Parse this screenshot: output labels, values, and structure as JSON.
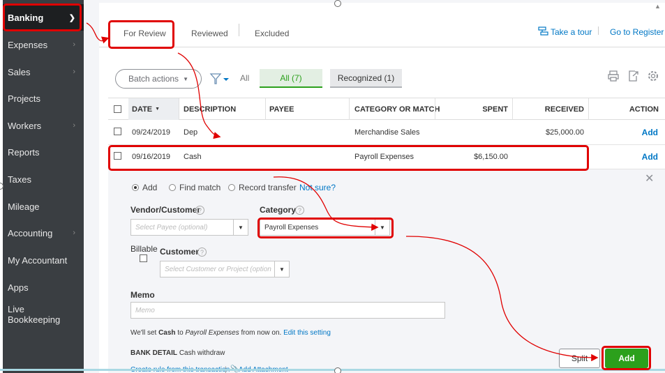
{
  "sidebar": {
    "items": [
      {
        "label": "Banking",
        "chevron": true,
        "active": true
      },
      {
        "label": "Expenses",
        "chevron": true
      },
      {
        "label": "Sales",
        "chevron": true
      },
      {
        "label": "Projects",
        "chevron": false
      },
      {
        "label": "Workers",
        "chevron": true
      },
      {
        "label": "Reports",
        "chevron": false
      },
      {
        "label": "Taxes",
        "chevron": false
      },
      {
        "label": "Mileage",
        "chevron": false
      },
      {
        "label": "Accounting",
        "chevron": true
      },
      {
        "label": "My Accountant",
        "chevron": false
      },
      {
        "label": "Apps",
        "chevron": false
      },
      {
        "label": "Live Bookkeeping",
        "chevron": false
      }
    ]
  },
  "tabs": {
    "for_review": "For Review",
    "reviewed": "Reviewed",
    "excluded": "Excluded"
  },
  "top_links": {
    "take_tour": "Take a tour",
    "go_register": "Go to Register"
  },
  "toolbar": {
    "batch_actions": "Batch actions",
    "all_label": "All",
    "tab_all": "All (7)",
    "tab_recognized": "Recognized (1)"
  },
  "table": {
    "headers": {
      "date": "DATE",
      "description": "DESCRIPTION",
      "payee": "PAYEE",
      "category": "CATEGORY OR MATCH",
      "spent": "SPENT",
      "received": "RECEIVED",
      "action": "ACTION"
    },
    "rows": [
      {
        "date": "09/24/2019",
        "description": "Dep",
        "payee": "",
        "category": "Merchandise Sales",
        "spent": "",
        "received": "$25,000.00",
        "action": "Add"
      },
      {
        "date": "09/16/2019",
        "description": "Cash",
        "payee": "",
        "category": "Payroll Expenses",
        "spent": "$6,150.00",
        "received": "",
        "action": "Add"
      }
    ]
  },
  "detail": {
    "radio_add": "Add",
    "radio_find": "Find match",
    "radio_transfer": "Record transfer",
    "not_sure": "Not sure?",
    "vendor_label": "Vendor/Customer",
    "vendor_placeholder": "Select Payee (optional)",
    "category_label": "Category",
    "category_value": "Payroll Expenses",
    "billable_label": "Billable",
    "customer_label": "Customer",
    "customer_placeholder": "Select Customer or Project (option",
    "memo_label": "Memo",
    "memo_placeholder": "Memo",
    "rule_prefix": "We'll set",
    "rule_payee": "Cash",
    "rule_mid": "to",
    "rule_category": "Payroll Expenses",
    "rule_suffix": "from now on.",
    "rule_edit": "Edit this setting",
    "bank_detail_label": "BANK DETAIL",
    "bank_detail_value": "Cash withdraw",
    "create_rule": "Create rule from this transaction",
    "add_attachment": "Add Attachment",
    "split": "Split",
    "add": "Add"
  },
  "colors": {
    "sidebar": "#3a3e42",
    "accent_green": "#2ca01c",
    "link_blue": "#0077c5",
    "annotation_red": "#e00000"
  }
}
